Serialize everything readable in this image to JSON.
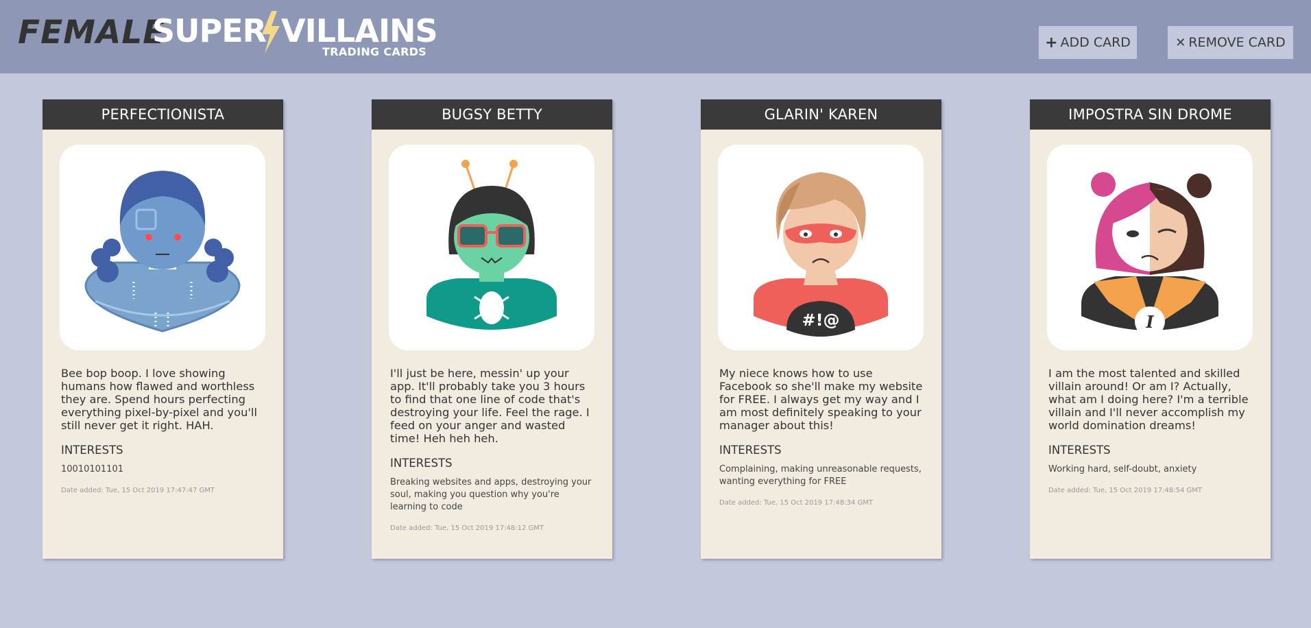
{
  "header": {
    "logo_female": "FEMALE",
    "logo_super": "SUPER",
    "logo_villains": "VILLAINS",
    "logo_sub": "TRADING CARDS",
    "add_symbol": "+",
    "add_label": "ADD CARD",
    "remove_symbol": "✕",
    "remove_label": "REMOVE CARD"
  },
  "colors": {
    "header_bg": "#8e98b6",
    "page_bg": "#c4c8dd",
    "card_bg": "#f2ece0",
    "card_title_bg": "#3a3a3a",
    "bolt": "#f5d98a"
  },
  "cards": [
    {
      "name": "PERFECTIONISTA",
      "portrait": "robot-villain-portrait",
      "bio": "Bee bop boop. I love showing humans how flawed and worthless they are. Spend hours perfecting everything pixel-by-pixel and you'll still never get it right. HAH.",
      "interests_heading": "INTERESTS",
      "interests": "10010101101",
      "date": "Date added: Tue, 15 Oct 2019 17:47:47 GMT"
    },
    {
      "name": "BUGSY BETTY",
      "portrait": "bug-villain-portrait",
      "bio": "I'll just be here, messin' up your app. It'll probably take you 3 hours to find that one line of code that's destroying your life. Feel the rage. I feed on your anger and wasted time! Heh heh heh.",
      "interests_heading": "INTERESTS",
      "interests": "Breaking websites and apps, destroying your soul, making you question why you're learning to code",
      "date": "Date added: Tue, 15 Oct 2019 17:48:12 GMT"
    },
    {
      "name": "GLARIN' KAREN",
      "portrait": "karen-villain-portrait",
      "shirt_text": "#!@",
      "bio": "My niece knows how to use Facebook so she'll make my website for FREE. I always get my way and I am most definitely speaking to your manager about this!",
      "interests_heading": "INTERESTS",
      "interests": "Complaining, making unreasonable requests, wanting everything for FREE",
      "date": "Date added: Tue, 15 Oct 2019 17:48:34 GMT"
    },
    {
      "name": "IMPOSTRA SIN DROME",
      "portrait": "impostor-villain-portrait",
      "emblem_text": "I",
      "bio": "I am the most talented and skilled villain around! Or am I? Actually, what am I doing here? I'm a terrible villain and I'll never accomplish my world domination dreams!",
      "interests_heading": "INTERESTS",
      "interests": "Working hard, self-doubt, anxiety",
      "date": "Date added: Tue, 15 Oct 2019 17:48:54 GMT"
    }
  ]
}
